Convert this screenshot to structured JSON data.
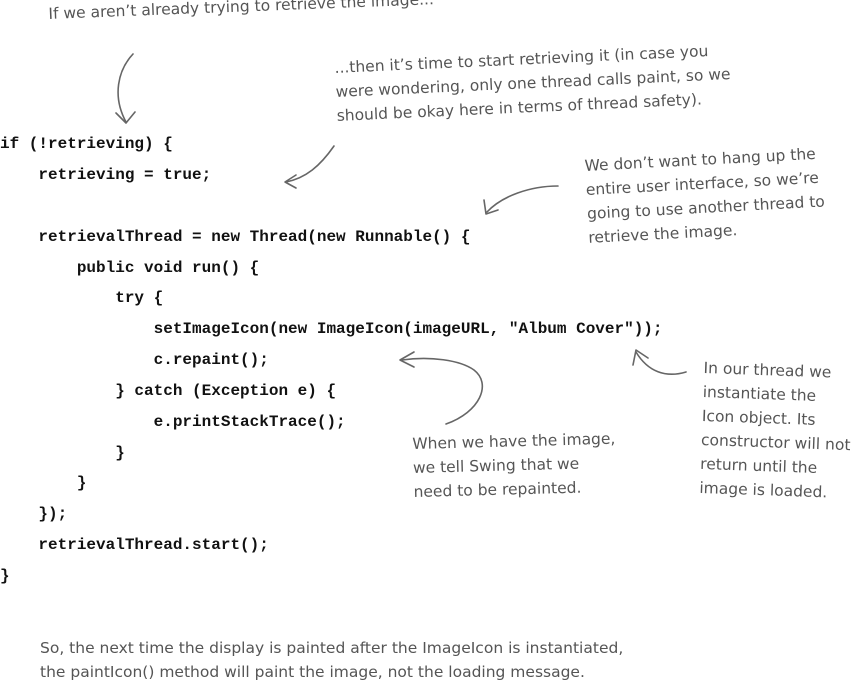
{
  "code": {
    "lines": [
      "if (!retrieving) {",
      "    retrieving = true;",
      "",
      "    retrievalThread = new Thread(new Runnable() {",
      "        public void run() {",
      "            try {",
      "                setImageIcon(new ImageIcon(imageURL, \"Album Cover\"));",
      "                c.repaint();",
      "            } catch (Exception e) {",
      "                e.printStackTrace();",
      "            }",
      "        }",
      "    });",
      "    retrievalThread.start();",
      "}"
    ]
  },
  "annotations": {
    "top": [
      "If we aren’t already trying to retrieve the image..."
    ],
    "retrieving": [
      "...then it’s time to start retrieving it (in case you",
      "were wondering, only one thread calls paint, so we",
      "should be okay here in terms of thread safety)."
    ],
    "thread": [
      "We don’t want to hang up the",
      "entire user interface, so we’re",
      "going to use another thread to",
      "retrieve the image."
    ],
    "instantiate": [
      "In our thread we",
      "instantiate the",
      "Icon object. Its",
      "constructor will not",
      "return until the",
      "image is loaded."
    ],
    "repaint": [
      "When we have the image,",
      "we tell Swing that we",
      "need to be repainted."
    ],
    "bottom": [
      "So, the next time the display is painted after the ImageIcon is instantiated,",
      "the paintIcon() method will paint the image, not the loading message."
    ]
  }
}
